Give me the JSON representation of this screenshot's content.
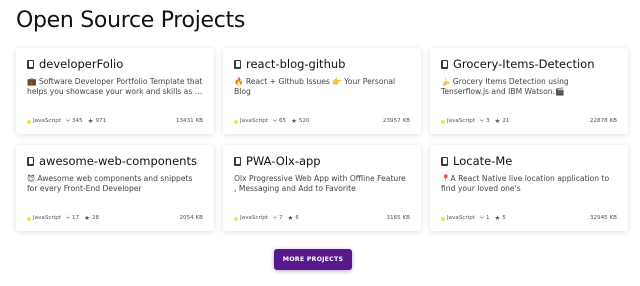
{
  "section": {
    "title": "Open Source Projects"
  },
  "colors": {
    "accent": "#55198b",
    "javascript": "#f1e05a"
  },
  "projects": [
    {
      "name": "developerFolio",
      "description": "💼 Software Developer Portfolio Template that helps you showcase your work and skills as a software developer.",
      "language": "JavaScript",
      "forks": "345",
      "stars": "971",
      "size": "13431 KB"
    },
    {
      "name": "react-blog-github",
      "description": "🔥 React + Github Issues 👉 Your Personal Blog",
      "language": "JavaScript",
      "forks": "65",
      "stars": "520",
      "size": "23957 KB"
    },
    {
      "name": "Grocery-Items-Detection",
      "description": "🍌 Grocery Items Detection using Tenserflow.js and IBM Watson.🎬",
      "language": "JavaScript",
      "forks": "3",
      "stars": "21",
      "size": "22878 KB"
    },
    {
      "name": "awesome-web-components",
      "description": "😈 Awesome web components and snippets for every Front-End Developer",
      "language": "JavaScript",
      "forks": "17",
      "stars": "28",
      "size": "2054 KB"
    },
    {
      "name": "PWA-Olx-app",
      "description": "Olx Progressive Web App with Offline Feature , Messaging and Add to Favorite",
      "language": "JavaScript",
      "forks": "7",
      "stars": "6",
      "size": "3165 KB"
    },
    {
      "name": "Locate-Me",
      "description": "📍A React Native live location application to find your loved one's",
      "language": "JavaScript",
      "forks": "1",
      "stars": "5",
      "size": "32945 KB"
    }
  ],
  "icons": {
    "repo": "book-icon",
    "fork": "fork-icon",
    "star": "star-icon",
    "language": "language-dot"
  },
  "more_button": {
    "label": "MORE PROJECTS"
  }
}
